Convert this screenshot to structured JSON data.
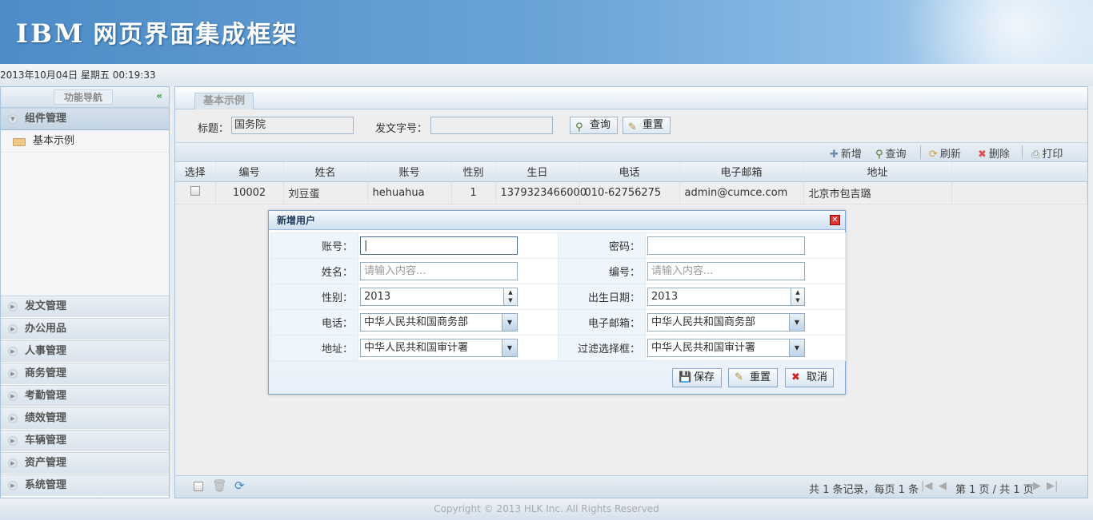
{
  "header": {
    "logo": "IBM",
    "title": "网页界面集成框架"
  },
  "datetime": "2013年10月04日 星期五 00:19:33",
  "sidebar": {
    "title": "功能导航",
    "collapse_icon": "«",
    "open_group": "组件管理",
    "open_items": [
      "基本示例"
    ],
    "groups": [
      "发文管理",
      "办公用品",
      "人事管理",
      "商务管理",
      "考勤管理",
      "绩效管理",
      "车辆管理",
      "资产管理",
      "系统管理"
    ]
  },
  "main": {
    "tab": "基本示例",
    "search": {
      "title_label": "标题：",
      "title_value": "国务院",
      "docno_label": "发文字号：",
      "docno_value": "",
      "query": "查询",
      "reset": "重置"
    },
    "toolbar": {
      "add": "新增",
      "query": "查询",
      "refresh": "刷新",
      "delete": "删除",
      "print": "打印"
    },
    "table": {
      "columns": [
        "选择",
        "编号",
        "姓名",
        "账号",
        "性别",
        "生日",
        "电话",
        "电子邮箱",
        "地址"
      ],
      "rows": [
        [
          "",
          "10002",
          "刘豆蛋",
          "hehuahua",
          "1",
          "1379323466000",
          "010-62756275",
          "admin@cumce.com",
          "北京市包吉璐"
        ]
      ]
    },
    "pager": {
      "summary": "共 1 条记录，每页 1 条",
      "page": "第 1 页 / 共 1 页"
    }
  },
  "dialog": {
    "title": "新增用户",
    "fields": [
      {
        "label": "账号：",
        "value": "",
        "placeholder": ""
      },
      {
        "label": "密码：",
        "value": "",
        "placeholder": ""
      },
      {
        "label": "姓名：",
        "value": "",
        "placeholder": "请输入内容..."
      },
      {
        "label": "编号：",
        "value": "",
        "placeholder": "请输入内容..."
      },
      {
        "label": "性别：",
        "value": "2013"
      },
      {
        "label": "出生日期：",
        "value": "2013"
      },
      {
        "label": "电话：",
        "value": "中华人民共和国商务部"
      },
      {
        "label": "电子邮箱：",
        "value": "中华人民共和国商务部"
      },
      {
        "label": "地址：",
        "value": "中华人民共和国审计署"
      },
      {
        "label": "过滤选择框：",
        "value": "中华人民共和国审计署"
      }
    ],
    "save": "保存",
    "reset": "重置",
    "cancel": "取消"
  },
  "footer": "Copyright © 2013 HLK Inc. All Rights Reserved"
}
